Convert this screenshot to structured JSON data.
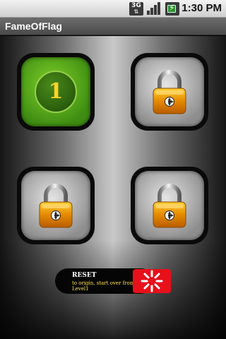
{
  "status_bar": {
    "network": "3G",
    "time": "1:30 PM",
    "icons": [
      "3g-network-icon",
      "signal-strength-icon",
      "battery-charging-icon"
    ]
  },
  "app": {
    "title": "FameOfFlag"
  },
  "levels": [
    {
      "label": "1",
      "state": "unlocked",
      "icon": "level-badge-icon"
    },
    {
      "label": "",
      "state": "locked",
      "icon": "padlock-icon"
    },
    {
      "label": "",
      "state": "locked",
      "icon": "padlock-icon"
    },
    {
      "label": "",
      "state": "locked",
      "icon": "padlock-icon"
    }
  ],
  "reset": {
    "title": "RESET",
    "description": "to origin, start over from Level1",
    "icon": "reset-spinner-icon"
  },
  "colors": {
    "unlocked_tile": "#5fae1c",
    "level_number": "#ffd42a",
    "reset_icon_bg": "#e8101a",
    "reset_desc": "#ffe14a"
  }
}
